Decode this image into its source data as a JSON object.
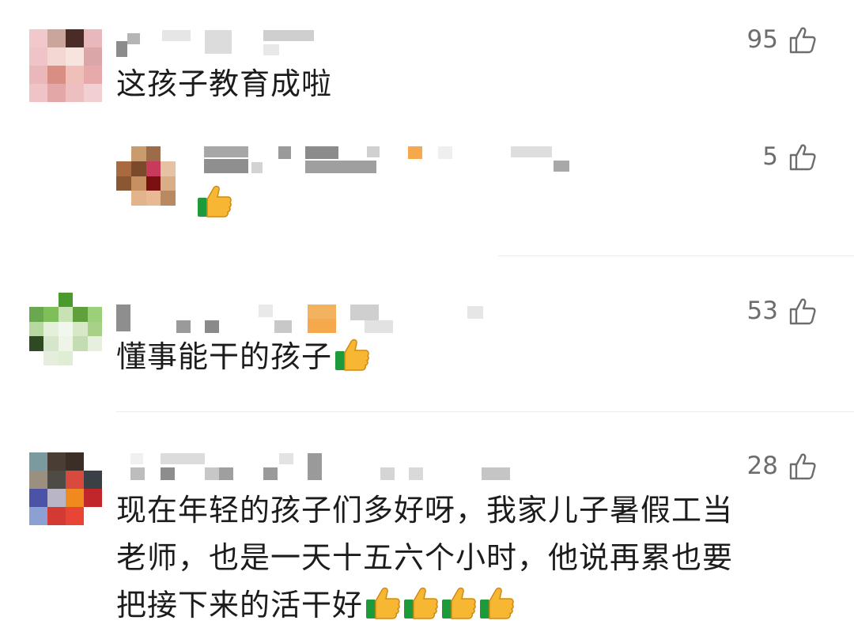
{
  "comments": [
    {
      "text": "这孩子教育成啦",
      "likes": "95"
    },
    {
      "text": "",
      "likes": "5",
      "is_reply": true
    },
    {
      "text": "懂事能干的孩子",
      "likes": "53"
    },
    {
      "lines": [
        "现在年轻的孩子们多好呀，我家儿子暑假工当",
        "老师，也是一天十五六个小时，他说再累也要",
        "把接下来的活干好"
      ],
      "likes": "28"
    }
  ],
  "icons": {
    "like": "thumbs-up-outline-icon",
    "emoji": "thumbs-up-emoji-icon"
  },
  "colors": {
    "text": "#1c1c1c",
    "like": "#6d6d6d",
    "divider": "#ececec"
  }
}
